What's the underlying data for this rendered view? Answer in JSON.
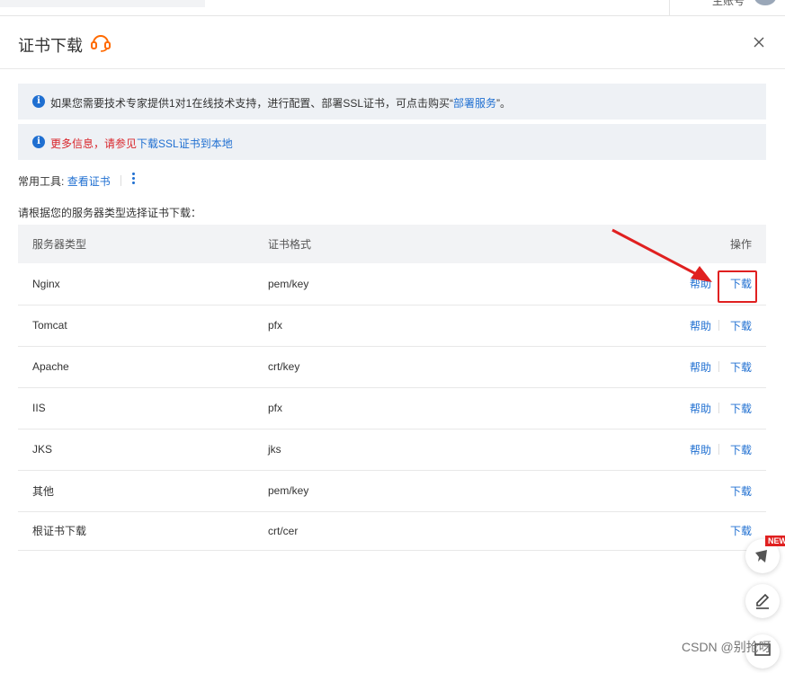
{
  "topbar": {
    "account_label": "主账号"
  },
  "modal": {
    "title": "证书下载",
    "notices": [
      {
        "prefix": "如果您需要技术专家提供1对1在线技术支持，进行配置、部署SSL证书，可点击购买“",
        "link": "部署服务",
        "suffix": "”。"
      },
      {
        "red_text": "更多信息，请参见",
        "link": "下载SSL证书到本地"
      }
    ],
    "tools": {
      "label": "常用工具:",
      "link": "查看证书"
    },
    "instruction": "请根据您的服务器类型选择证书下载：",
    "table": {
      "headers": [
        "服务器类型",
        "证书格式",
        "操作"
      ],
      "rows": [
        {
          "server": "Nginx",
          "format": "pem/key",
          "help": "帮助",
          "download": "下载"
        },
        {
          "server": "Tomcat",
          "format": "pfx",
          "help": "帮助",
          "download": "下载"
        },
        {
          "server": "Apache",
          "format": "crt/key",
          "help": "帮助",
          "download": "下载"
        },
        {
          "server": "IIS",
          "format": "pfx",
          "help": "帮助",
          "download": "下载"
        },
        {
          "server": "JKS",
          "format": "jks",
          "help": "帮助",
          "download": "下载"
        },
        {
          "server": "其他",
          "format": "pem/key",
          "help": "",
          "download": "下载"
        },
        {
          "server": "根证书下载",
          "format": "crt/cer",
          "help": "",
          "download": "下载"
        }
      ]
    }
  },
  "floating": {
    "new_badge": "NEW"
  },
  "watermark": "CSDN @别抢呀",
  "colors": {
    "link": "#1f6fd1",
    "highlight": "#e02020",
    "notice_bg": "#eef1f5"
  }
}
